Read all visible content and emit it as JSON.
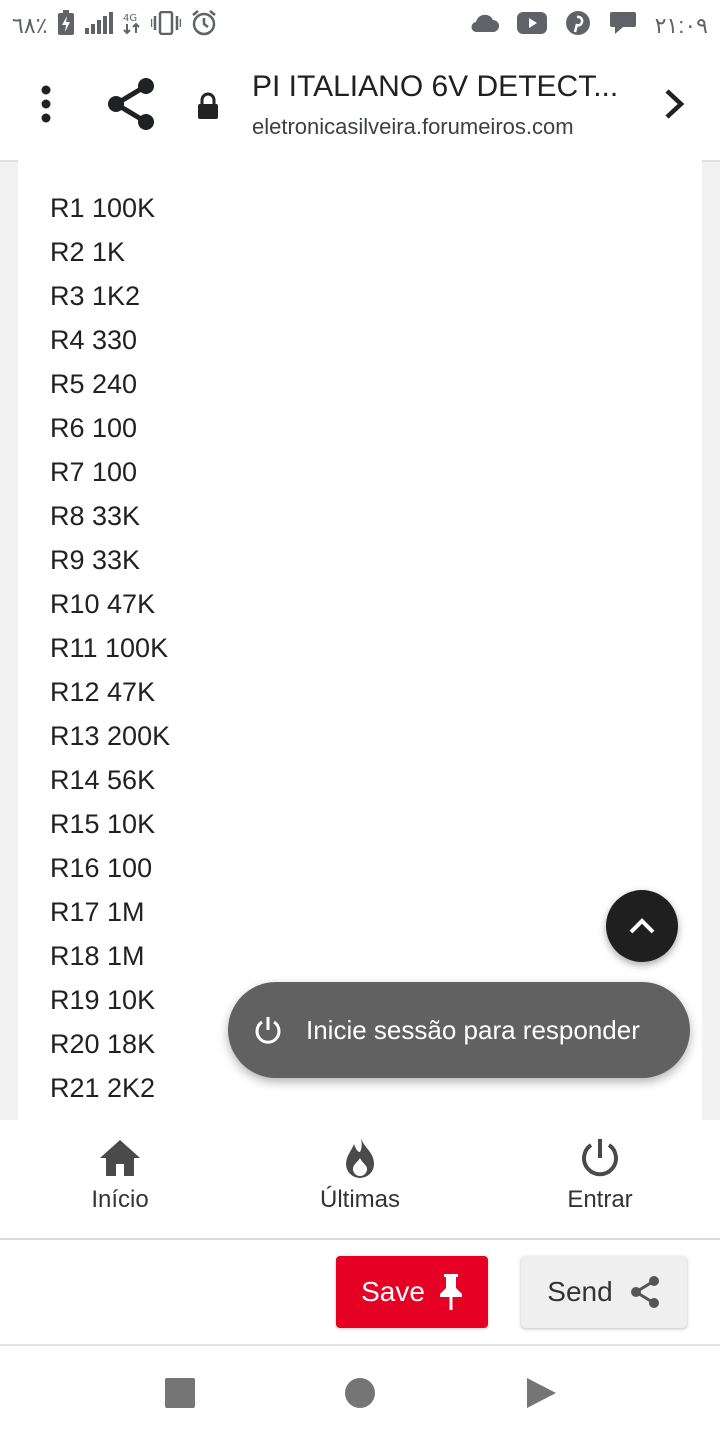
{
  "status_bar": {
    "battery_percent": "٦٨٪",
    "network": "4G",
    "time": "٢١:٠٩",
    "left_icons": [
      "battery-charging-icon",
      "signal-icon",
      "network-4g-icon",
      "vibrate-icon",
      "alarm-icon"
    ],
    "right_icons": [
      "cloud-icon",
      "youtube-icon",
      "pinterest-icon",
      "chat-icon"
    ]
  },
  "toolbar": {
    "title": "PI ITALIANO 6V DETECT...",
    "url": "eletronicasilveira.forumeiros.com"
  },
  "resistors": [
    "R1 100K",
    "R2 1K",
    "R3 1K2",
    "R4 330",
    "R5 240",
    "R6 100",
    "R7 100",
    "R8 33K",
    "R9 33K",
    "R10 47K",
    "R11 100K",
    "R12 47K",
    "R13 200K",
    "R14 56K",
    "R15 10K",
    "R16 100",
    "R17 1M",
    "R18 1M",
    "R19 10K",
    "R20 18K",
    "R21 2K2"
  ],
  "toast": {
    "label": "Inicie sessão para responder"
  },
  "bottom_nav": {
    "items": [
      {
        "label": "Início",
        "icon": "home-icon"
      },
      {
        "label": "Últimas",
        "icon": "fire-icon"
      },
      {
        "label": "Entrar",
        "icon": "power-icon"
      }
    ]
  },
  "actions": {
    "save_label": "Save",
    "send_label": "Send"
  },
  "colors": {
    "save_red": "#e60023",
    "toast_gray": "#616161",
    "fab_dark": "#1f1f1f"
  }
}
